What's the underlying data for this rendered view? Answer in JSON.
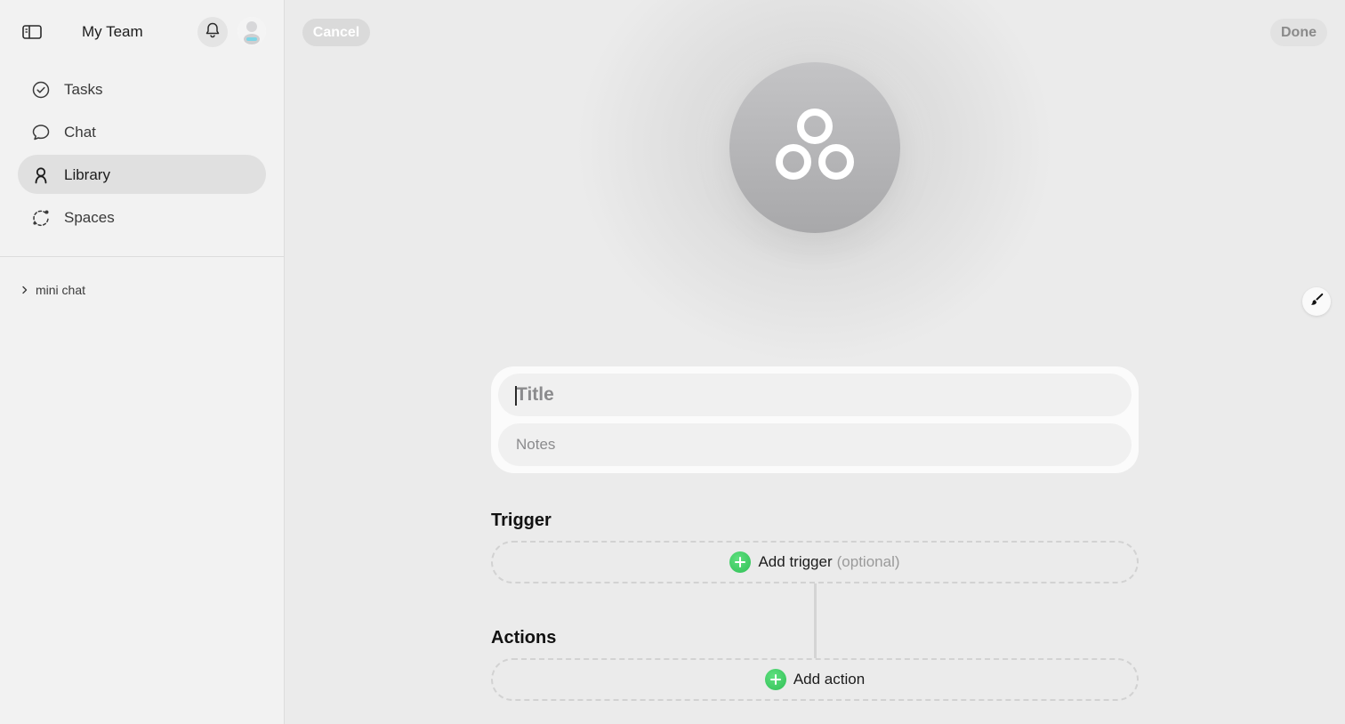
{
  "sidebar": {
    "title": "My Team",
    "nav": [
      {
        "id": "tasks",
        "label": "Tasks",
        "icon": "check-circle-icon",
        "active": false
      },
      {
        "id": "chat",
        "label": "Chat",
        "icon": "chat-bubble-icon",
        "active": false
      },
      {
        "id": "library",
        "label": "Library",
        "icon": "person-icon",
        "active": true
      },
      {
        "id": "spaces",
        "label": "Spaces",
        "icon": "spaces-icon",
        "active": false
      }
    ],
    "group": {
      "label": "mini chat",
      "icon": "chevron-right-icon"
    }
  },
  "toolbar": {
    "cancel_label": "Cancel",
    "done_label": "Done"
  },
  "form": {
    "title_placeholder": "Title",
    "title_value": "",
    "notes_placeholder": "Notes",
    "notes_value": ""
  },
  "trigger": {
    "heading": "Trigger",
    "add_label": "Add trigger",
    "optional_label": "(optional)"
  },
  "actions": {
    "heading": "Actions",
    "add_label": "Add action"
  },
  "colors": {
    "accent_green": "#34c759",
    "active_nav_bg": "#e0e0e0",
    "hero_gray": "#b4b4b6"
  }
}
